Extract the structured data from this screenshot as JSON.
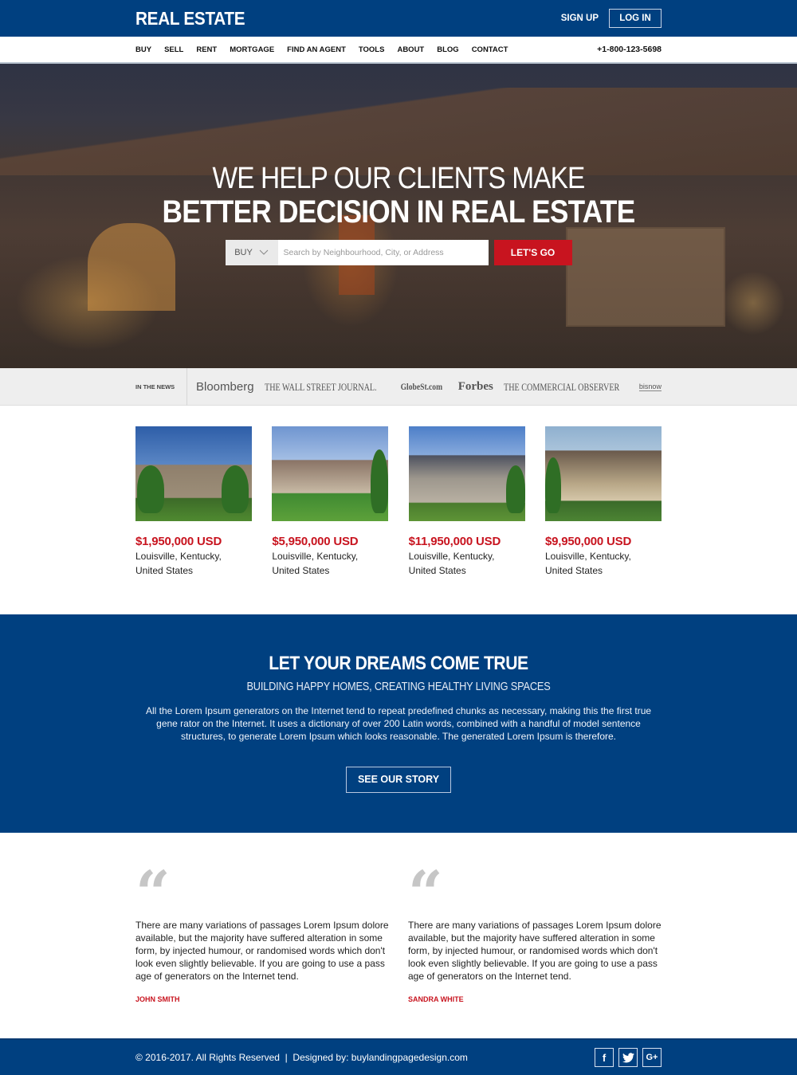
{
  "header": {
    "logo": "REAL ESTATE",
    "signup": "SIGN UP",
    "login": "LOG IN"
  },
  "nav": {
    "items": [
      "BUY",
      "SELL",
      "RENT",
      "MORTGAGE",
      "FIND AN AGENT",
      "TOOLS",
      "ABOUT",
      "BLOG",
      "CONTACT"
    ],
    "phone": "+1-800-123-5698"
  },
  "hero": {
    "line1": "WE HELP OUR CLIENTS MAKE",
    "line2": "BETTER DECISION IN REAL ESTATE",
    "search_type": "BUY",
    "search_placeholder": "Search by Neighbourhood, City, or Address",
    "search_value": "",
    "go_button": "LET'S GO"
  },
  "news": {
    "label": "IN THE NEWS",
    "logos": [
      "Bloomberg",
      "THE WALL STREET JOURNAL.",
      "GlobeSt.com",
      "Forbes",
      "THE COMMERCIAL OBSERVER",
      "bisnow"
    ]
  },
  "listings": [
    {
      "price": "$1,950,000 USD",
      "city": "Louisville, Kentucky,",
      "country": "United States"
    },
    {
      "price": "$5,950,000 USD",
      "city": "Louisville, Kentucky,",
      "country": "United States"
    },
    {
      "price": "$11,950,000 USD",
      "city": "Louisville, Kentucky,",
      "country": "United States"
    },
    {
      "price": "$9,950,000 USD",
      "city": "Louisville, Kentucky,",
      "country": "United States"
    }
  ],
  "dreams": {
    "title": "LET YOUR DREAMS COME TRUE",
    "subtitle": "BUILDING HAPPY HOMES, CREATING HEALTHY LIVING SPACES",
    "body": "All the Lorem Ipsum generators on the Internet tend to repeat predefined chunks as necessary, making this the first true gene rator on the Internet. It uses a dictionary of over 200 Latin words, combined with a handful of model sentence structures, to generate Lorem Ipsum which looks reasonable. The generated Lorem Ipsum is therefore.",
    "button": "SEE OUR STORY"
  },
  "testimonials": [
    {
      "text": "There are many variations of passages Lorem Ipsum dolore available, but the majority have suffered alteration in some form, by injected humour, or randomised words which don't look even slightly believable. If you are going to use a pass age of generators on the Internet tend.",
      "author": "JOHN SMITH"
    },
    {
      "text": "There are many variations of passages Lorem Ipsum dolore available, but the majority have suffered alteration in some form, by injected humour, or randomised words which don't look even slightly believable. If you are going to use a pass age of generators on the Internet tend.",
      "author": "SANDRA WHITE"
    }
  ],
  "footer": {
    "copyright": "© 2016-2017. All Rights Reserved  |  Designed by: buylandingpagedesign.com",
    "social": [
      {
        "icon": "facebook-icon",
        "glyph": "f"
      },
      {
        "icon": "twitter-icon",
        "glyph": "t"
      },
      {
        "icon": "google-plus-icon",
        "glyph": "G+"
      }
    ]
  },
  "colors": {
    "brand_blue": "#004080",
    "accent_red": "#c8141f",
    "news_bg": "#eeeeee"
  }
}
